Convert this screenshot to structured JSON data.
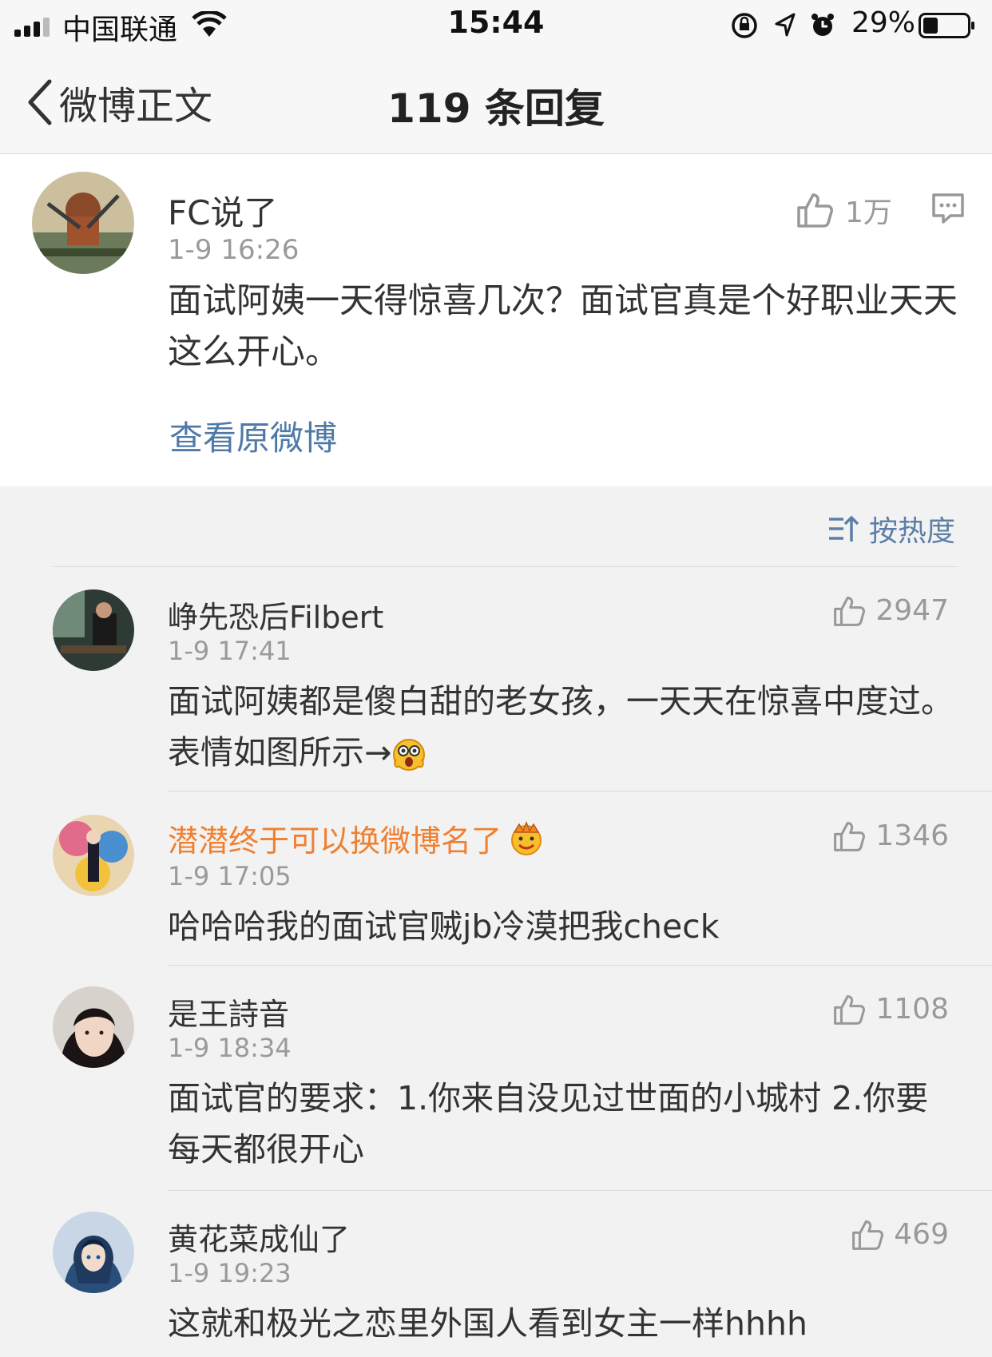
{
  "status_bar": {
    "carrier": "中国联通",
    "time": "15:44",
    "battery": "29%"
  },
  "nav": {
    "back_label": "微博正文",
    "title": "119 条回复"
  },
  "post": {
    "author": "FC说了",
    "time": "1-9 16:26",
    "likes": "1万",
    "text": "面试阿姨一天得惊喜几次？面试官真是个好职业天天这么开心。",
    "view_original": "查看原微博"
  },
  "sort": {
    "label": "按热度"
  },
  "comments": [
    {
      "author": "峥先恐后Filbert",
      "time": "1-9 17:41",
      "likes": "2947",
      "text": "面试阿姨都是傻白甜的老女孩，一天天在惊喜中度过。表情如图所示→"
    },
    {
      "author": "潜潜终于可以换微博名了",
      "time": "1-9 17:05",
      "likes": "1346",
      "text": "哈哈哈我的面试官贼jb冷漠把我check"
    },
    {
      "author": "是王詩音",
      "time": "1-9 18:34",
      "likes": "1108",
      "text": "面试官的要求：1.你来自没见过世面的小城村 2.你要每天都很开心"
    },
    {
      "author": "黄花菜成仙了",
      "time": "1-9 19:23",
      "likes": "469",
      "text": "这就和极光之恋里外国人看到女主一样hhhh"
    }
  ],
  "colors": {
    "link": "#4f7aa8",
    "vip_name": "#f08030",
    "meta": "#9a9a9a"
  },
  "icons": {
    "like": "thumbs-up-icon",
    "comment": "comment-icon",
    "sort": "sort-icon",
    "back": "chevron-left-icon"
  }
}
